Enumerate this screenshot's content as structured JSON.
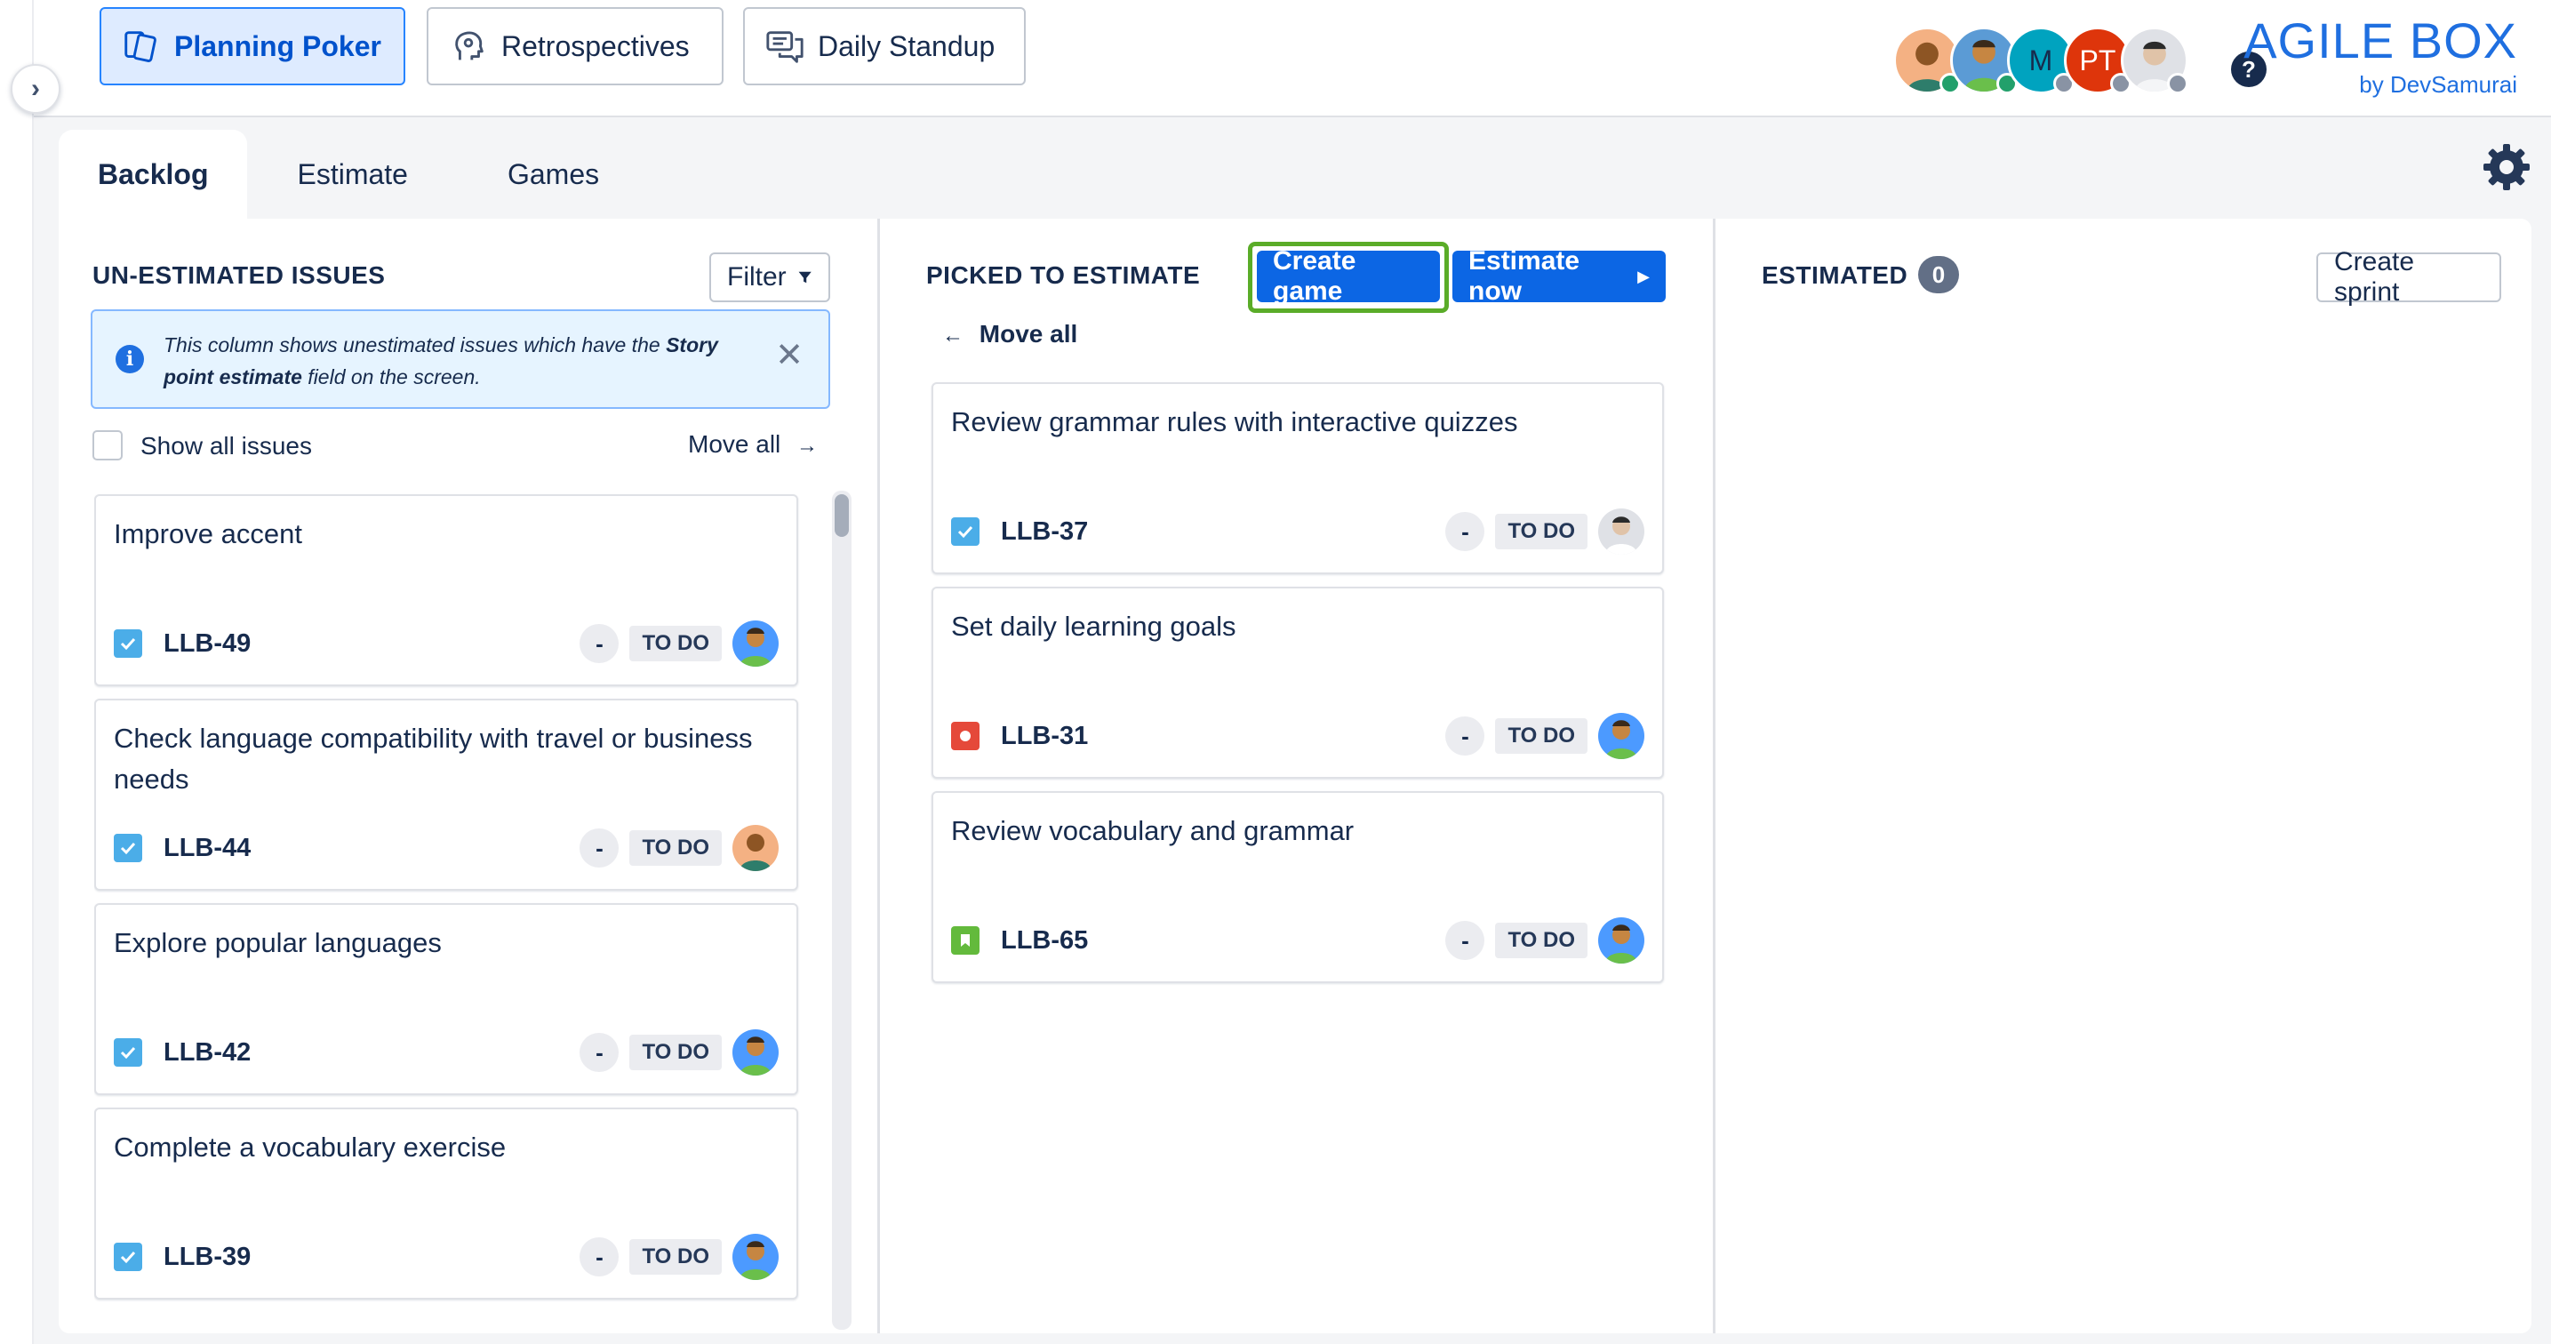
{
  "nav": {
    "items": [
      {
        "label": "Planning Poker",
        "icon": "cards-icon",
        "active": true
      },
      {
        "label": "Retrospectives",
        "icon": "head-icon",
        "active": false
      },
      {
        "label": "Daily Standup",
        "icon": "chat-icon",
        "active": false
      }
    ]
  },
  "presence": {
    "users": [
      {
        "initials": "",
        "bg": "#f4b183"
      },
      {
        "initials": "",
        "bg": "#5b9bd5"
      },
      {
        "initials": "M",
        "bg": "#00a3bf"
      },
      {
        "initials": "PT",
        "bg": "#de350b"
      },
      {
        "initials": "",
        "bg": "#dfe1e6"
      }
    ],
    "help_label": "?"
  },
  "brand": {
    "title": "AGILE BOX",
    "subtitle": "by DevSamurai"
  },
  "tabs": [
    {
      "label": "Backlog",
      "active": true
    },
    {
      "label": "Estimate",
      "active": false
    },
    {
      "label": "Games",
      "active": false
    }
  ],
  "backlog": {
    "title": "UN-ESTIMATED ISSUES",
    "filter_label": "Filter",
    "info_pre": "This column shows unestimated issues which have the ",
    "info_bold": "Story point estimate",
    "info_post": " field on the screen.",
    "show_all_label": "Show all issues",
    "move_all_label": "Move all",
    "issues": [
      {
        "title": "Improve accent",
        "key": "LLB-49",
        "type": "task",
        "points": "-",
        "status": "TO DO",
        "assignee": "teal"
      },
      {
        "title": "Check language compatibility with travel or business needs",
        "key": "LLB-44",
        "type": "task",
        "points": "-",
        "status": "TO DO",
        "assignee": "peach"
      },
      {
        "title": "Explore popular languages",
        "key": "LLB-42",
        "type": "task",
        "points": "-",
        "status": "TO DO",
        "assignee": "teal"
      },
      {
        "title": "Complete a vocabulary exercise",
        "key": "LLB-39",
        "type": "task",
        "points": "-",
        "status": "TO DO",
        "assignee": "teal"
      }
    ]
  },
  "picked": {
    "title": "PICKED TO ESTIMATE",
    "create_game_label": "Create game",
    "estimate_now_label": "Estimate now",
    "move_all_label": "Move all",
    "issues": [
      {
        "title": "Review grammar rules with interactive quizzes",
        "key": "LLB-37",
        "type": "task",
        "points": "-",
        "status": "TO DO",
        "assignee": "gray"
      },
      {
        "title": "Set daily learning goals",
        "key": "LLB-31",
        "type": "bug",
        "points": "-",
        "status": "TO DO",
        "assignee": "teal"
      },
      {
        "title": "Review vocabulary and grammar",
        "key": "LLB-65",
        "type": "story",
        "points": "-",
        "status": "TO DO",
        "assignee": "teal"
      }
    ]
  },
  "estimated": {
    "title": "ESTIMATED",
    "count": "0",
    "create_sprint_label": "Create sprint"
  }
}
